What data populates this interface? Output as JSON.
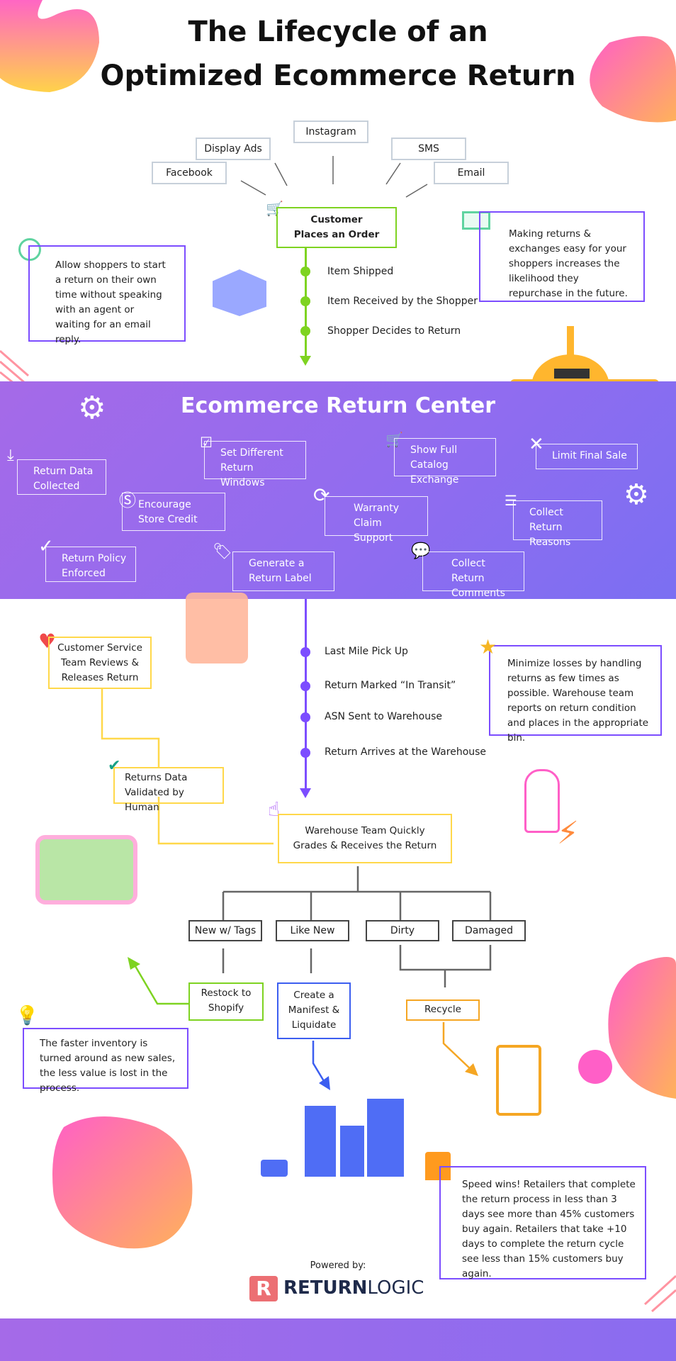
{
  "title": {
    "line1": "The Lifecycle of an",
    "line2": "Optimized Ecommerce Return"
  },
  "sources": [
    "Facebook",
    "Display Ads",
    "Instagram",
    "SMS",
    "Email"
  ],
  "order": {
    "label_line1": "Customer",
    "label_line2": "Places an Order"
  },
  "shipping_steps": [
    "Item Shipped",
    "Item Received by the Shopper",
    "Shopper Decides to Return"
  ],
  "notes": {
    "self_service": "Allow shoppers to start a return on their own time without speaking with an agent or waiting for an email reply.",
    "repurchase": "Making returns & exchanges easy for your shoppers increases the likelihood they repurchase in the future.",
    "minimize": "Minimize losses by handling returns as few times as possible. Warehouse team reports on return condition and places in the appropriate bin.",
    "inventory": "The faster inventory is turned around as new sales, the less value is lost in the process.",
    "speed": "Speed wins! Retailers that complete the return process in less than 3 days see more than 45% customers buy again. Retailers that take +10 days to complete the return cycle see less than 15% customers buy again."
  },
  "return_center": {
    "title": "Ecommerce Return Center",
    "features": [
      "Return Data Collected",
      "Set Different Return Windows",
      "Show Full Catalog Exchange",
      "Limit Final Sale",
      "Encourage Store Credit",
      "Warranty Claim Support",
      "Collect Return Reasons",
      "Return Policy Enforced",
      "Generate a Return Label",
      "Collect Return Comments"
    ]
  },
  "transit_steps": [
    "Last Mile Pick Up",
    "Return Marked “In Transit”",
    "ASN Sent to Warehouse",
    "Return Arrives at the Warehouse"
  ],
  "service": {
    "review": "Customer Service Team Reviews & Releases Return",
    "validated": "Returns Data Validated by Human"
  },
  "warehouse": "Warehouse Team Quickly Grades & Receives the Return",
  "grades": [
    "New w/ Tags",
    "Like New",
    "Dirty",
    "Damaged"
  ],
  "outcomes": {
    "restock": "Restock to Shopify",
    "liquidate": "Create a Manifest & Liquidate",
    "recycle": "Recycle"
  },
  "footer": {
    "powered_by": "Powered by:",
    "brand_bold": "RETURN",
    "brand_light": "LOGIC"
  },
  "colors": {
    "purple": "#7c4dff",
    "green": "#7ed321",
    "yellow": "#ffd84a",
    "blue": "#3c5ef0",
    "orange": "#f5a623",
    "pink": "#ff5fc7"
  }
}
